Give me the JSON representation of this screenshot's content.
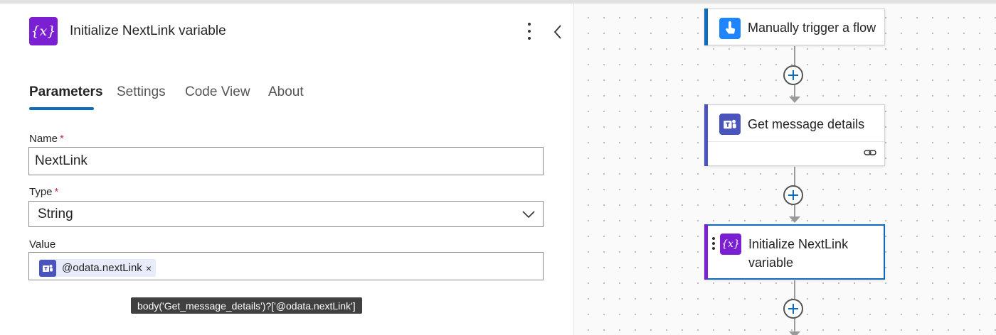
{
  "panel": {
    "icon_symbol": "{x}",
    "title": "Initialize NextLink variable",
    "more_icon": "more-vertical-icon",
    "collapse_icon": "chevron-left-icon",
    "tabs": [
      {
        "label": "Parameters",
        "active": true
      },
      {
        "label": "Settings",
        "active": false
      },
      {
        "label": "Code View",
        "active": false
      },
      {
        "label": "About",
        "active": false
      }
    ],
    "fields": {
      "name": {
        "label": "Name",
        "required_mark": "*",
        "value": "NextLink"
      },
      "type": {
        "label": "Type",
        "required_mark": "*",
        "value": "String"
      },
      "value": {
        "label": "Value",
        "token": "@odata.nextLink",
        "token_remove": "×"
      }
    },
    "tooltip": "body('Get_message_details')?['@odata.nextLink']"
  },
  "canvas": {
    "cards": [
      {
        "title": "Manually trigger a flow",
        "icon": "touch-icon",
        "color": "#1f85ff"
      },
      {
        "title": "Get message details",
        "icon": "teams-icon",
        "color": "#4b53bc",
        "footer_icon": "link-icon"
      },
      {
        "title_line1": "Initialize NextLink",
        "title_line2": "variable",
        "icon_symbol": "{x}",
        "color": "#7a1fd1",
        "selected": true
      }
    ]
  },
  "colors": {
    "accent": "#0f6cbd",
    "variable": "#7a1fd1",
    "teams": "#4b53bc",
    "trigger": "#1f85ff"
  }
}
